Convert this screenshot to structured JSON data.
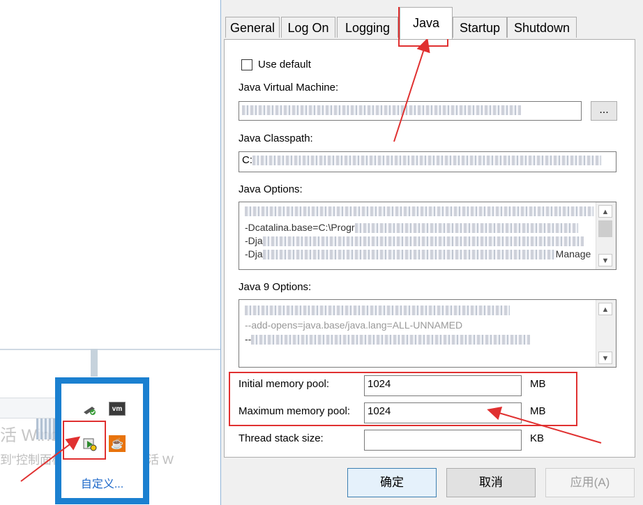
{
  "desktop": {
    "watermark_line1": "活 Windows",
    "watermark_line2": "到\"控制面板\"中的\"系统\"以激活 W"
  },
  "tray": {
    "customize_label": "自定义...",
    "vm_icon_text": "vm",
    "icons": [
      "usb-icon",
      "vmware-icon",
      "tomcat-monitor-icon",
      "java-icon"
    ]
  },
  "tabs": [
    "General",
    "Log On",
    "Logging",
    "Java",
    "Startup",
    "Shutdown"
  ],
  "active_tab": "Java",
  "java_tab": {
    "use_default_label": "Use default",
    "use_default_checked": false,
    "jvm_label": "Java Virtual Machine:",
    "jvm_browse_label": "...",
    "classpath_label": "Java Classpath:",
    "classpath_value": "C:",
    "options_label": "Java Options:",
    "options_lines": [
      "-Dcatalina.base=C:\\Progr",
      "-Dja",
      "-Dja",
      "Manage"
    ],
    "java9_label": "Java 9 Options:",
    "java9_lines": [
      "--add-opens=java.base/java.lang=ALL-UNNAMED",
      "--"
    ],
    "initial_pool_label": "Initial memory pool:",
    "initial_pool_value": "1024",
    "initial_pool_unit": "MB",
    "max_pool_label": "Maximum memory pool:",
    "max_pool_value": "1024",
    "max_pool_unit": "MB",
    "stack_label": "Thread stack size:",
    "stack_value": "",
    "stack_unit": "KB"
  },
  "buttons": {
    "ok": "确定",
    "cancel": "取消",
    "apply": "应用(A)"
  },
  "annotation_color": "#e03030"
}
